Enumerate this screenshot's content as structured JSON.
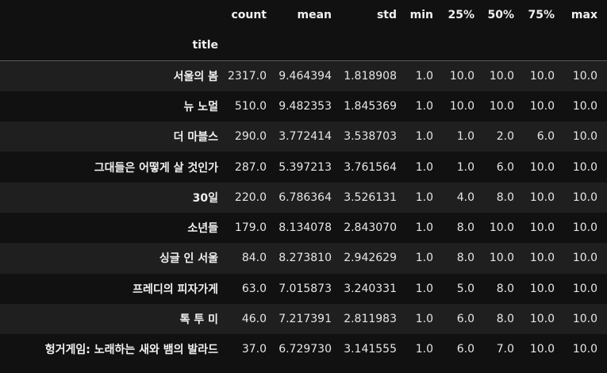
{
  "table": {
    "index_name": "title",
    "columns": [
      "count",
      "mean",
      "std",
      "min",
      "25%",
      "50%",
      "75%",
      "max"
    ],
    "rows": [
      {
        "title": "서울의 봄",
        "values": [
          "2317.0",
          "9.464394",
          "1.818908",
          "1.0",
          "10.0",
          "10.0",
          "10.0",
          "10.0"
        ]
      },
      {
        "title": "뉴 노멀",
        "values": [
          "510.0",
          "9.482353",
          "1.845369",
          "1.0",
          "10.0",
          "10.0",
          "10.0",
          "10.0"
        ]
      },
      {
        "title": "더 마블스",
        "values": [
          "290.0",
          "3.772414",
          "3.538703",
          "1.0",
          "1.0",
          "2.0",
          "6.0",
          "10.0"
        ]
      },
      {
        "title": "그대들은 어떻게 살 것인가",
        "values": [
          "287.0",
          "5.397213",
          "3.761564",
          "1.0",
          "1.0",
          "6.0",
          "10.0",
          "10.0"
        ]
      },
      {
        "title": "30일",
        "values": [
          "220.0",
          "6.786364",
          "3.526131",
          "1.0",
          "4.0",
          "8.0",
          "10.0",
          "10.0"
        ]
      },
      {
        "title": "소년들",
        "values": [
          "179.0",
          "8.134078",
          "2.843070",
          "1.0",
          "8.0",
          "10.0",
          "10.0",
          "10.0"
        ]
      },
      {
        "title": "싱글 인 서울",
        "values": [
          "84.0",
          "8.273810",
          "2.942629",
          "1.0",
          "8.0",
          "10.0",
          "10.0",
          "10.0"
        ]
      },
      {
        "title": "프레디의 피자가게",
        "values": [
          "63.0",
          "7.015873",
          "3.240331",
          "1.0",
          "5.0",
          "8.0",
          "10.0",
          "10.0"
        ]
      },
      {
        "title": "톡 투 미",
        "values": [
          "46.0",
          "7.217391",
          "2.811983",
          "1.0",
          "6.0",
          "8.0",
          "10.0",
          "10.0"
        ]
      },
      {
        "title": "헝거게임: 노래하는 새와 뱀의 발라드",
        "values": [
          "37.0",
          "6.729730",
          "3.141555",
          "1.0",
          "6.0",
          "7.0",
          "10.0",
          "10.0"
        ]
      }
    ]
  },
  "colors": {
    "background": "#111111",
    "row_stripe": "#1f1f1f",
    "text": "#e8e8e8",
    "header_rule": "#5a5a5a"
  }
}
